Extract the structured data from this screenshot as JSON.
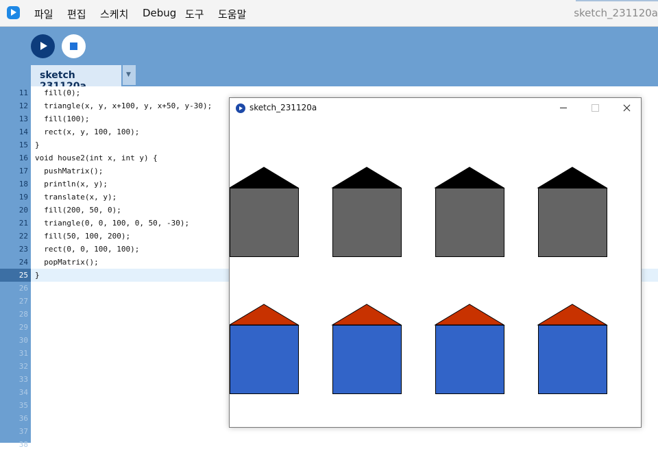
{
  "menu": {
    "file": "파일",
    "edit": "편집",
    "sketch": "스케치",
    "debug": "Debug",
    "tools": "도구",
    "help": "도움말"
  },
  "window_title": "sketch_231120a",
  "toolbar": {
    "run_icon": "play-icon",
    "stop_icon": "stop-icon",
    "tab_label": "sketch 231120a",
    "tab_menu_icon": "▼"
  },
  "editor": {
    "lines": [
      {
        "number": "11",
        "code": "  fill(0);"
      },
      {
        "number": "12",
        "code": "  triangle(x, y, x+100, y, x+50, y-30);"
      },
      {
        "number": "13",
        "code": "  fill(100);"
      },
      {
        "number": "14",
        "code": "  rect(x, y, 100, 100);"
      },
      {
        "number": "15",
        "code": "}"
      },
      {
        "number": "16",
        "code": "void house2(int x, int y) {"
      },
      {
        "number": "17",
        "code": "  pushMatrix();"
      },
      {
        "number": "18",
        "code": "  println(x, y);"
      },
      {
        "number": "19",
        "code": "  translate(x, y);"
      },
      {
        "number": "20",
        "code": "  fill(200, 50, 0);"
      },
      {
        "number": "21",
        "code": "  triangle(0, 0, 100, 0, 50, -30);"
      },
      {
        "number": "22",
        "code": "  fill(50, 100, 200);"
      },
      {
        "number": "23",
        "code": "  rect(0, 0, 100, 100);"
      },
      {
        "number": "24",
        "code": "  popMatrix();"
      },
      {
        "number": "25",
        "code": "}"
      }
    ],
    "empty_line_numbers": [
      "26",
      "27",
      "28",
      "29",
      "30",
      "31",
      "32",
      "33",
      "34",
      "35",
      "36",
      "37",
      "38"
    ],
    "current_line": "25"
  },
  "sketch_window": {
    "title": "sketch_231120a",
    "canvas": {
      "background": "#ffffff",
      "houses": [
        {
          "row": 0,
          "col": 0,
          "roof": "#000000",
          "body": "#646464"
        },
        {
          "row": 0,
          "col": 1,
          "roof": "#000000",
          "body": "#646464"
        },
        {
          "row": 0,
          "col": 2,
          "roof": "#000000",
          "body": "#646464"
        },
        {
          "row": 0,
          "col": 3,
          "roof": "#000000",
          "body": "#646464"
        },
        {
          "row": 1,
          "col": 0,
          "roof": "#c83200",
          "body": "#3264c8"
        },
        {
          "row": 1,
          "col": 1,
          "roof": "#c83200",
          "body": "#3264c8"
        },
        {
          "row": 1,
          "col": 2,
          "roof": "#c83200",
          "body": "#3264c8"
        },
        {
          "row": 1,
          "col": 3,
          "roof": "#c83200",
          "body": "#3264c8"
        }
      ]
    }
  },
  "colors": {
    "accent": "#6c9fd1",
    "run_button": "#0d3c7c",
    "stop_icon": "#1e72d8",
    "current_line_gutter": "#3c6fa4",
    "current_line_bg": "#e3f1fc"
  }
}
